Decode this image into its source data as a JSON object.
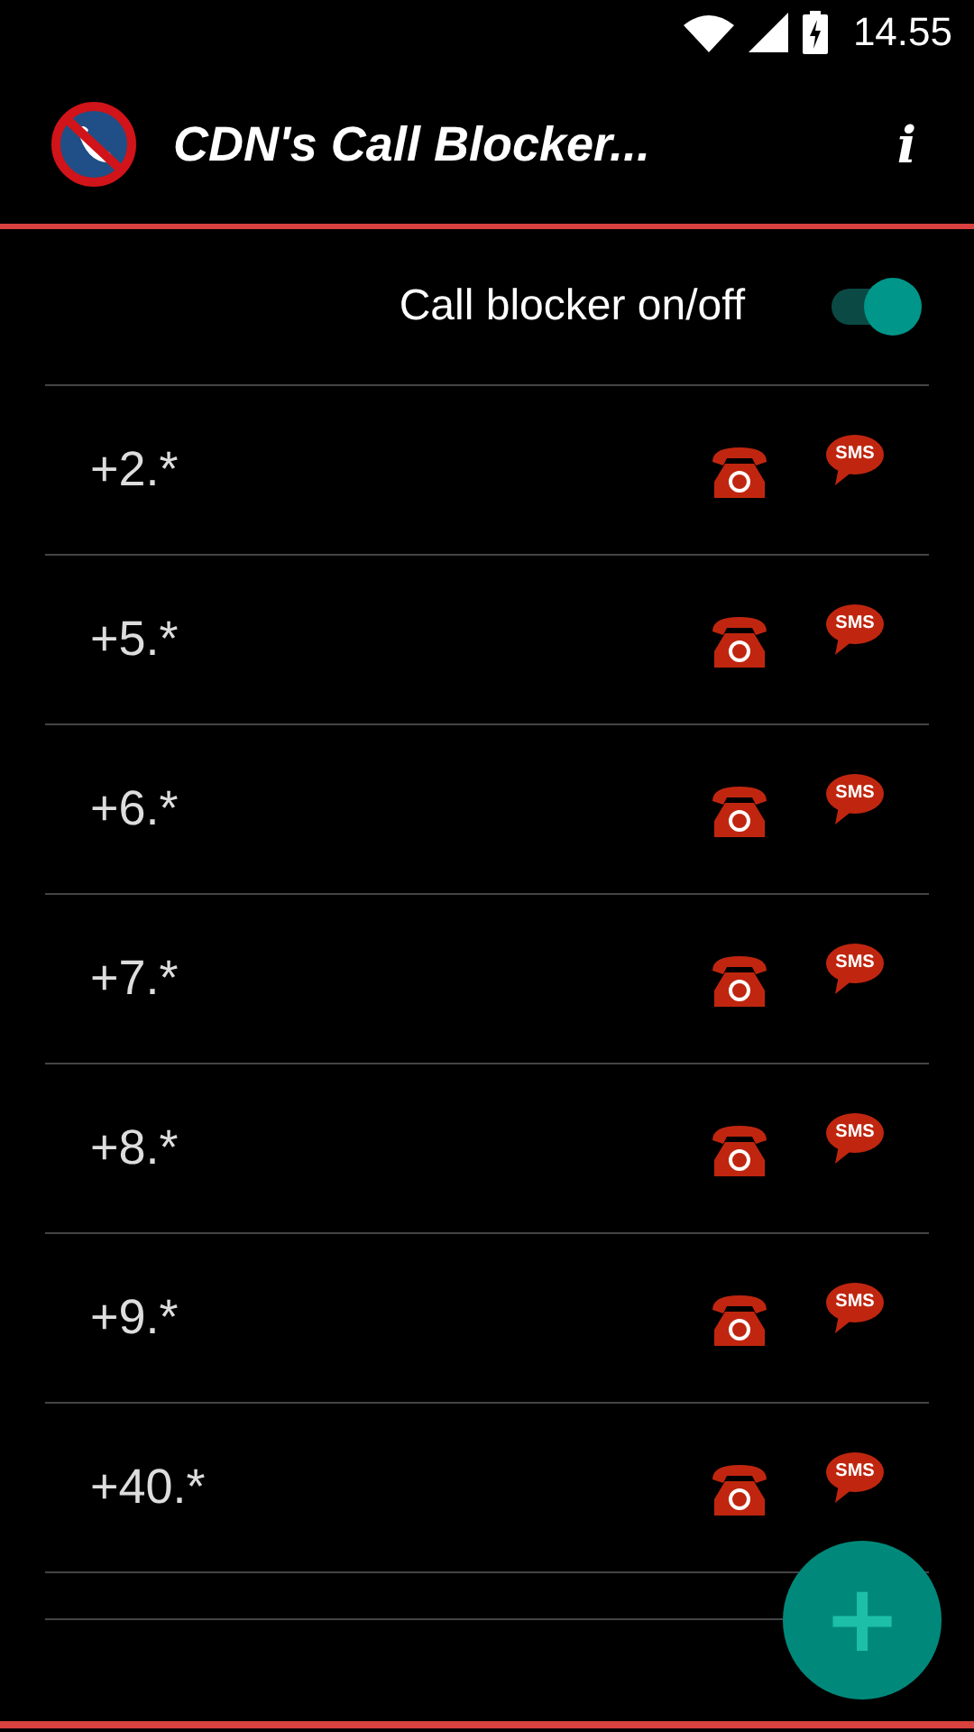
{
  "status_bar": {
    "time": "14.55"
  },
  "toolbar": {
    "title": "CDN's Call Blocker...",
    "info_button": "i"
  },
  "blocker_switch": {
    "label": "Call blocker on/off",
    "on": true
  },
  "rules": [
    {
      "pattern": "+2.*",
      "sms_label": "SMS"
    },
    {
      "pattern": "+5.*",
      "sms_label": "SMS"
    },
    {
      "pattern": "+6.*",
      "sms_label": "SMS"
    },
    {
      "pattern": "+7.*",
      "sms_label": "SMS"
    },
    {
      "pattern": "+8.*",
      "sms_label": "SMS"
    },
    {
      "pattern": "+9.*",
      "sms_label": "SMS"
    },
    {
      "pattern": "+40.*",
      "sms_label": "SMS"
    }
  ],
  "add_button": "+"
}
